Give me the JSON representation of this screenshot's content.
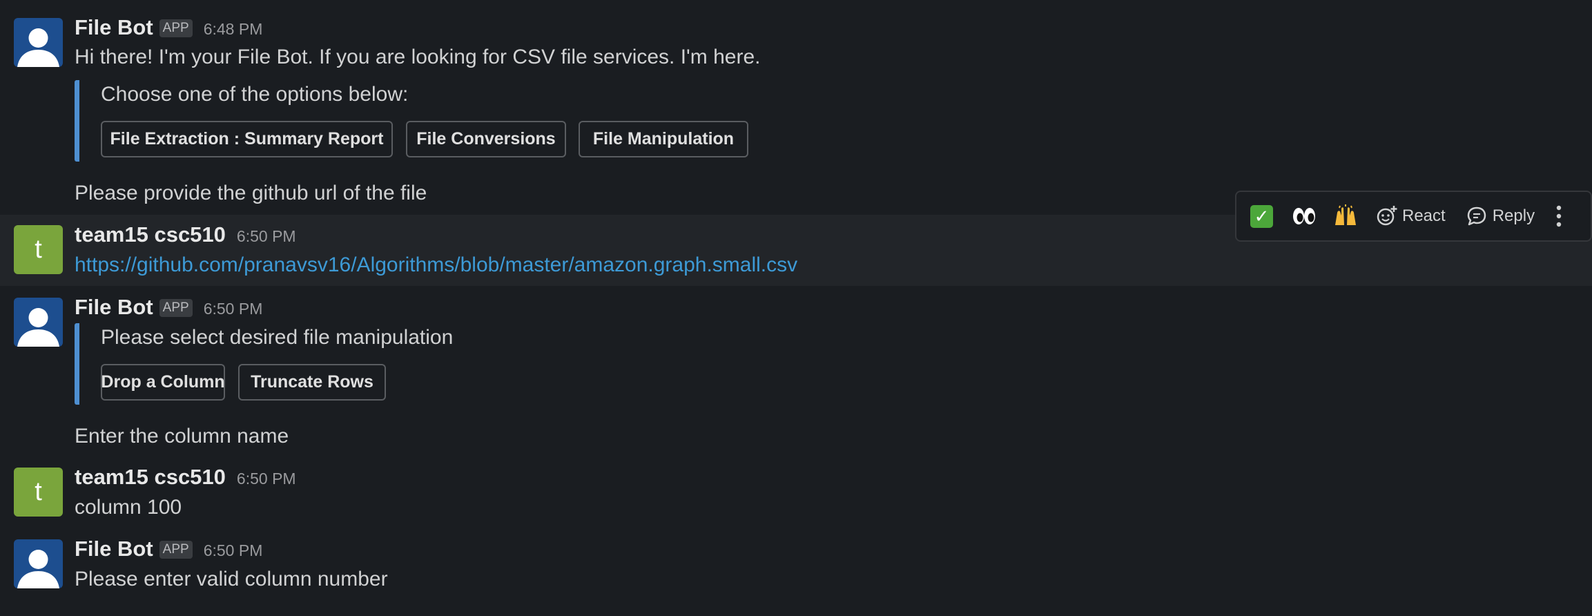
{
  "messages": {
    "m1": {
      "sender": "File Bot",
      "badge": "APP",
      "time": "6:48 PM",
      "text": "Hi there! I'm your File Bot. If you are looking for CSV file services. I'm here.",
      "attachment_text": "Choose one of the options below:",
      "buttons": [
        "File Extraction : Summary Report",
        "File Conversions",
        "File Manipulation"
      ],
      "followup": "Please provide the github url of the file"
    },
    "m2": {
      "sender": "team15 csc510",
      "initial": "t",
      "time": "6:50 PM",
      "text": "https://github.com/pranavsv16/Algorithms/blob/master/amazon.graph.small.csv"
    },
    "m3": {
      "sender": "File Bot",
      "badge": "APP",
      "time": "6:50 PM",
      "attachment_text": "Please select desired file manipulation",
      "buttons": [
        "Drop a Column",
        "Truncate Rows"
      ],
      "followup": "Enter the column name"
    },
    "m4": {
      "sender": "team15 csc510",
      "initial": "t",
      "time": "6:50 PM",
      "text": "column 100"
    },
    "m5": {
      "sender": "File Bot",
      "badge": "APP",
      "time": "6:50 PM",
      "text": "Please enter valid column number"
    }
  },
  "toolbar": {
    "react_label": "React",
    "reply_label": "Reply",
    "icons": [
      "white-check-mark-emoji",
      "eyes-emoji",
      "raised-hands-emoji",
      "add-reaction-icon",
      "reply-thread-icon",
      "more-actions-icon"
    ]
  },
  "colors": {
    "background": "#1a1d21",
    "link": "#3d9ad6",
    "attachment_bar": "#4e8fd1",
    "bot_avatar": "#1d4e8f",
    "user_avatar": "#7aa53c"
  }
}
